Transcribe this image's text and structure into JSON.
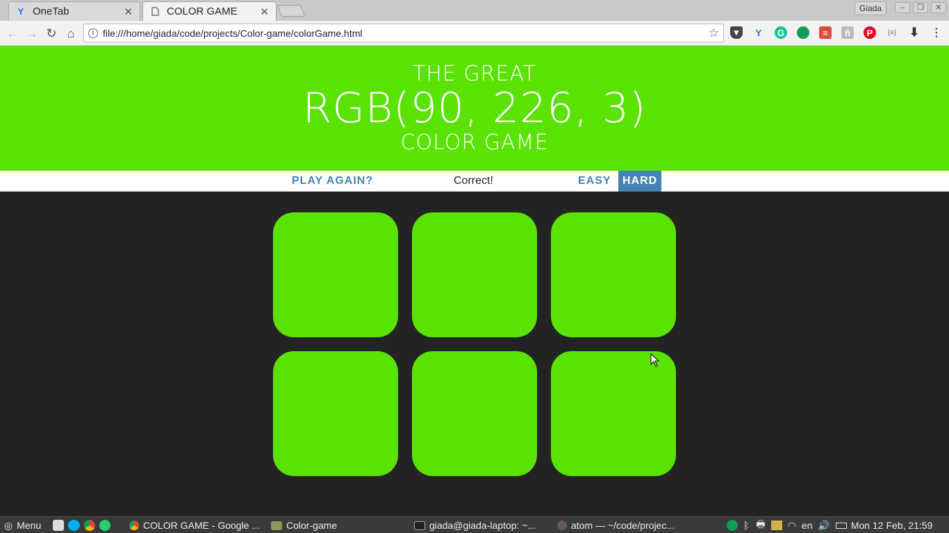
{
  "browser": {
    "tabs": [
      {
        "title": "OneTab",
        "icon": "onetab-icon",
        "active": false
      },
      {
        "title": "COLOR GAME",
        "icon": "page-icon",
        "active": true
      }
    ],
    "profile_name": "Giada",
    "url": "file:///home/giada/code/projects/Color-game/colorGame.html"
  },
  "game": {
    "header": {
      "line1": "The Great",
      "rgb_display": "RGB(90, 226, 3)",
      "line3": "Color Game"
    },
    "header_color": "#5ae203",
    "reset_label": "Play Again?",
    "message": "Correct!",
    "mode_easy_label": "Easy",
    "mode_hard_label": "Hard",
    "selected_mode": "Hard",
    "square_colors": [
      "#5ae203",
      "#5ae203",
      "#5ae203",
      "#5ae203",
      "#5ae203",
      "#5ae203"
    ]
  },
  "taskbar": {
    "menu_label": "Menu",
    "windows": [
      {
        "title": "COLOR GAME - Google ...",
        "icon": "chrome-icon"
      },
      {
        "title": "Color-game",
        "icon": "folder-icon"
      },
      {
        "title": "giada@giada-laptop: ~...",
        "icon": "terminal-icon"
      },
      {
        "title": "atom — ~/code/projec...",
        "icon": "atom-icon"
      }
    ],
    "language": "en",
    "clock": "Mon 12 Feb, 21:59"
  }
}
